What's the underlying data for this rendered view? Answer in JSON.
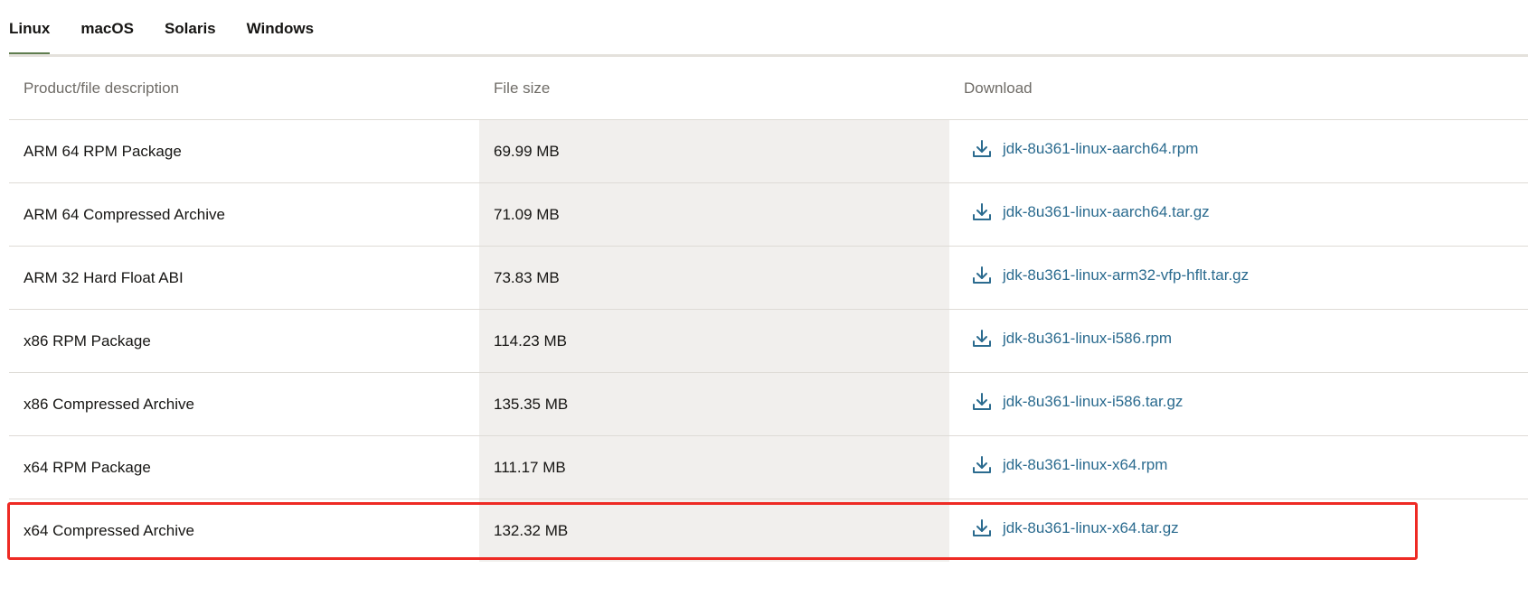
{
  "tabs": [
    {
      "label": "Linux",
      "active": true
    },
    {
      "label": "macOS",
      "active": false
    },
    {
      "label": "Solaris",
      "active": false
    },
    {
      "label": "Windows",
      "active": false
    }
  ],
  "table": {
    "headers": [
      "Product/file description",
      "File size",
      "Download"
    ],
    "rows": [
      {
        "description": "ARM 64 RPM Package",
        "size": "69.99 MB",
        "file": "jdk-8u361-linux-aarch64.rpm"
      },
      {
        "description": "ARM 64 Compressed Archive",
        "size": "71.09 MB",
        "file": "jdk-8u361-linux-aarch64.tar.gz"
      },
      {
        "description": "ARM 32 Hard Float ABI",
        "size": "73.83 MB",
        "file": "jdk-8u361-linux-arm32-vfp-hflt.tar.gz"
      },
      {
        "description": "x86 RPM Package",
        "size": "114.23 MB",
        "file": "jdk-8u361-linux-i586.rpm"
      },
      {
        "description": "x86 Compressed Archive",
        "size": "135.35 MB",
        "file": "jdk-8u361-linux-i586.tar.gz"
      },
      {
        "description": "x64 RPM Package",
        "size": "111.17 MB",
        "file": "jdk-8u361-linux-x64.rpm"
      },
      {
        "description": "x64 Compressed Archive",
        "size": "132.32 MB",
        "file": "jdk-8u361-linux-x64.tar.gz"
      }
    ],
    "highlighted_row_index": 6,
    "download_icon": "download-icon"
  },
  "colors": {
    "accent": "#5f7d4f",
    "link": "#2b6b8f",
    "highlight": "#ee2a24",
    "size_column_bg": "#f1efed"
  }
}
